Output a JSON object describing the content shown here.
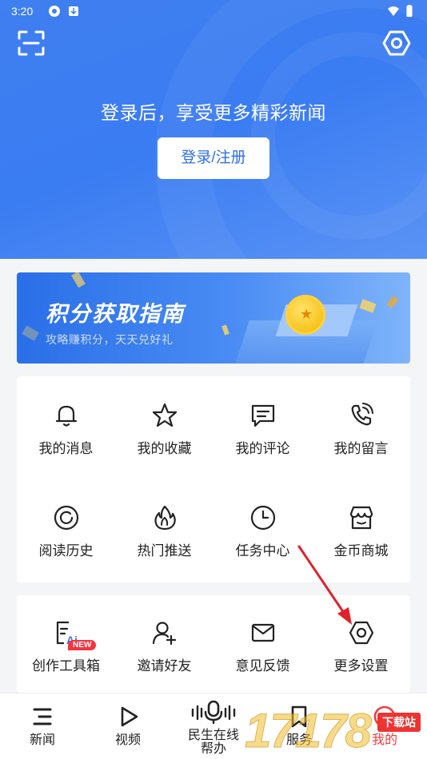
{
  "status_bar": {
    "time": "3:20"
  },
  "header": {
    "login_prompt": "登录后，享受更多精彩新闻",
    "login_button": "登录/注册"
  },
  "banner": {
    "title": "积分获取指南",
    "subtitle": "攻略赚积分，天天兑好礼"
  },
  "menu_primary": [
    {
      "label": "我的消息",
      "icon": "bell-icon"
    },
    {
      "label": "我的收藏",
      "icon": "star-icon"
    },
    {
      "label": "我的评论",
      "icon": "comment-icon"
    },
    {
      "label": "我的留言",
      "icon": "phone-icon"
    },
    {
      "label": "阅读历史",
      "icon": "history-icon"
    },
    {
      "label": "热门推送",
      "icon": "flame-icon"
    },
    {
      "label": "任务中心",
      "icon": "clock-icon"
    },
    {
      "label": "金币商城",
      "icon": "store-icon"
    }
  ],
  "menu_secondary": [
    {
      "label": "创作工具箱",
      "icon": "ai-tool-icon",
      "badge": "NEW"
    },
    {
      "label": "邀请好友",
      "icon": "add-user-icon"
    },
    {
      "label": "意见反馈",
      "icon": "mail-icon"
    },
    {
      "label": "更多设置",
      "icon": "settings-icon"
    }
  ],
  "tabbar": [
    {
      "label": "新闻",
      "icon": "news-icon",
      "active": false
    },
    {
      "label": "视频",
      "icon": "play-icon",
      "active": false
    },
    {
      "label": "民生在线帮办",
      "icon": "microphone-icon",
      "active": false
    },
    {
      "label": "服务",
      "icon": "bookmark-icon",
      "active": false
    },
    {
      "label": "我的",
      "icon": "profile-icon",
      "active": true
    }
  ],
  "watermark": {
    "text": "17178",
    "tag": "下载站"
  },
  "colors": {
    "primary": "#3a7cf2",
    "active_tab": "#ef3d3d",
    "badge": "#f5343f"
  }
}
